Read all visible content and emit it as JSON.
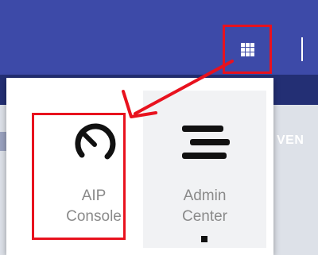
{
  "header": {
    "apps_button_icon": "app-grid-icon",
    "nav_partial_label": "VEN"
  },
  "app_launcher": {
    "apps": [
      {
        "label_line1": "AIP",
        "label_line2": "Console",
        "icon": "gauge-icon"
      },
      {
        "label_line1": "Admin",
        "label_line2": "Center",
        "icon": "menu-lines-icon"
      }
    ]
  },
  "annotations": {
    "highlight_color": "#e8121e",
    "arrow_icon": "red-arrow"
  }
}
